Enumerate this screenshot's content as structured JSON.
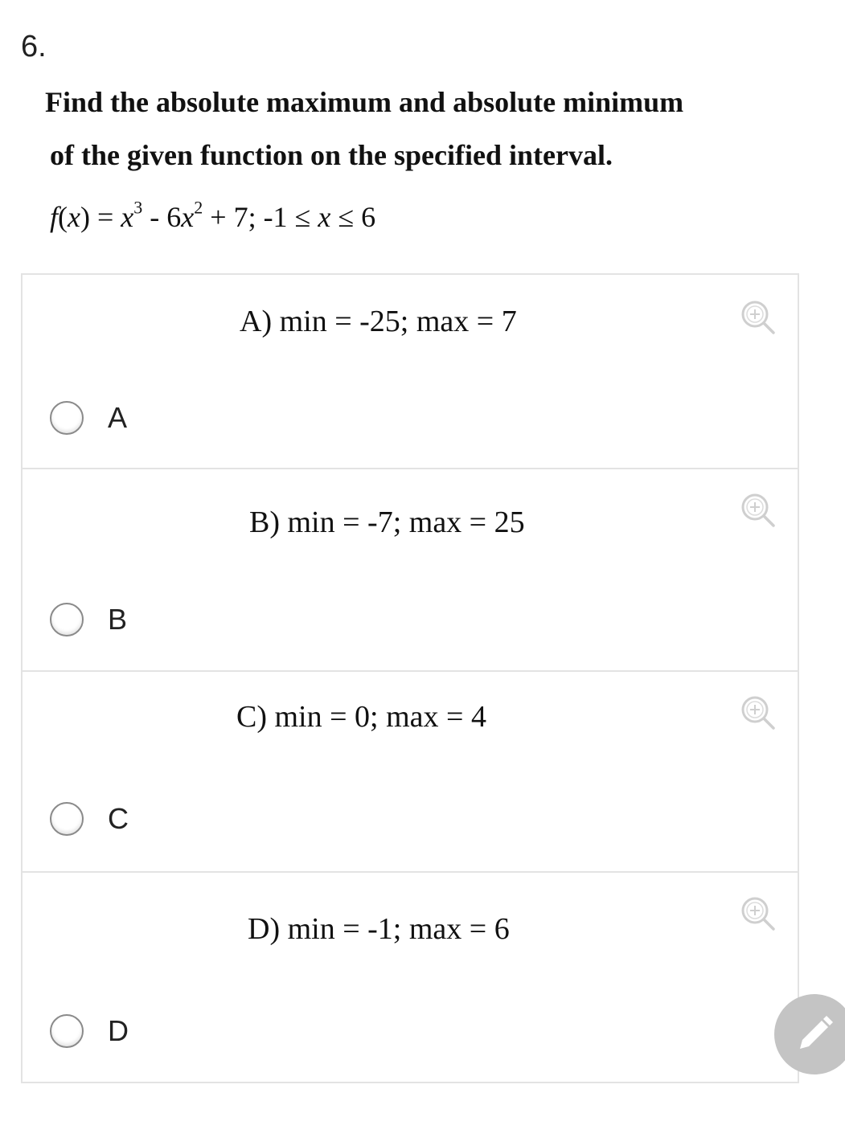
{
  "question": {
    "number": "6.",
    "prompt_line1": "Find the absolute maximum and absolute minimum",
    "prompt_line2": "of the given function on the specified  interval.",
    "formula": {
      "f": "f",
      "x1": "x",
      "eq": ") = ",
      "x_cubed_base": "x",
      "cube_exp": "3",
      "minus6": " - 6",
      "x_sq_base": "x",
      "sq_exp": "2",
      "rest": " + 7; -1 ≤ ",
      "x_mid": "x",
      "tail": " ≤ 6"
    }
  },
  "options": [
    {
      "text": "A) min = -25; max = 7",
      "radio_label": "A",
      "selected": false
    },
    {
      "text": "B) min = -7; max = 25",
      "radio_label": "B",
      "selected": false
    },
    {
      "text": "C) min = 0; max = 4",
      "radio_label": "C",
      "selected": false
    },
    {
      "text": "D) min = -1; max = 6",
      "radio_label": "D",
      "selected": false
    }
  ],
  "icons": {
    "zoom": "zoom-in-icon",
    "fab": "pencil-icon"
  },
  "colors": {
    "border": "#e3e3e3",
    "radio_border": "#8a8a8a",
    "fab_bg": "#c4c4c4",
    "zoom_icon": "#cfcfcf"
  }
}
